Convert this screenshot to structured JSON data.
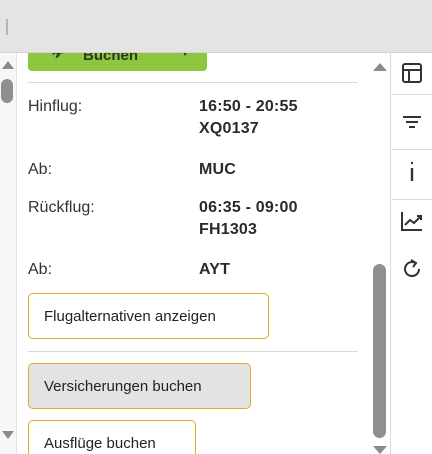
{
  "booking": {
    "book_label": "Buchen"
  },
  "flight": {
    "outbound_label": "Hinflug:",
    "outbound_time": "16:50 - 20:55",
    "outbound_number": "XQ0137",
    "outbound_from_label": "Ab:",
    "outbound_from_value": "MUC",
    "return_label": "Rückflug:",
    "return_time": "06:35 - 09:00",
    "return_number": "FH1303",
    "return_from_label": "Ab:",
    "return_from_value": "AYT"
  },
  "actions": {
    "alternatives_label": "Flugalternativen anzeigen",
    "insurance_label": "Versicherungen buchen",
    "excursions_label": "Ausflüge buchen"
  },
  "toolbar": {
    "icons": [
      "table-icon",
      "filter-icon",
      "info-icon",
      "chart-icon",
      "refresh-icon"
    ]
  },
  "colors": {
    "book_button": "#8dc63f",
    "outline_border": "#e3a928",
    "topbar": "#e4e4e4"
  }
}
